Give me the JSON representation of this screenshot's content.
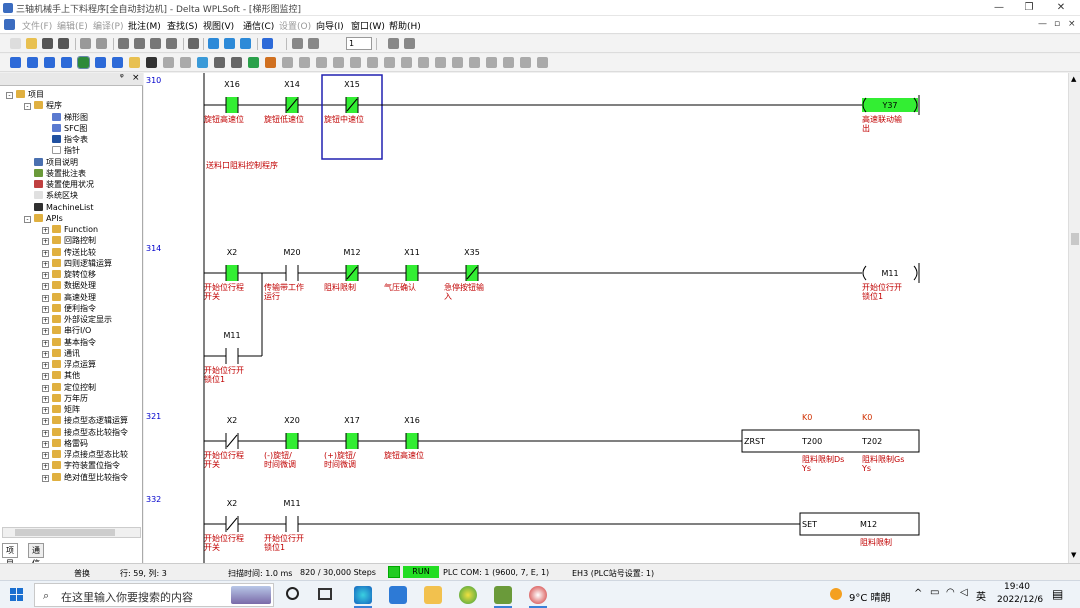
{
  "window": {
    "title": "三轴机械手上下料程序[全自动封边机] - Delta WPLSoft - [梯形图监控]",
    "controls": [
      "—",
      "❐",
      "✕"
    ]
  },
  "menu": {
    "items": [
      {
        "label": "文件(F)",
        "enabled": false
      },
      {
        "label": "编辑(E)",
        "enabled": false
      },
      {
        "label": "编译(P)",
        "enabled": false
      },
      {
        "label": "批注(M)",
        "enabled": true
      },
      {
        "label": "查找(S)",
        "enabled": true
      },
      {
        "label": "视图(V)",
        "enabled": true
      },
      {
        "label": "通信(C)",
        "enabled": true
      },
      {
        "label": "设置(O)",
        "enabled": false
      },
      {
        "label": "向导(I)",
        "enabled": true
      },
      {
        "label": "窗口(W)",
        "enabled": true
      },
      {
        "label": "帮助(H)",
        "enabled": true
      }
    ],
    "mdi_controls": [
      "—",
      "▫",
      "×"
    ]
  },
  "toolbar": {
    "step_value": "1"
  },
  "left_panel": {
    "pin_label": "ᵠ",
    "close_label": "×",
    "tree": [
      {
        "label": "项目",
        "level": 0,
        "pm": "-",
        "icon": "project-icon",
        "color": "#e0b040"
      },
      {
        "label": "程序",
        "level": 1,
        "pm": "-",
        "icon": "program-icon",
        "color": "#e0b040"
      },
      {
        "label": "梯形图",
        "level": 2,
        "pm": "",
        "icon": "ladder-icon",
        "color": "#5a7ad0"
      },
      {
        "label": "SFC图",
        "level": 2,
        "pm": "",
        "icon": "sfc-icon",
        "color": "#5a7ad0"
      },
      {
        "label": "指令表",
        "level": 2,
        "pm": "",
        "icon": "instruction-list-icon",
        "color": "#2050a0"
      },
      {
        "label": "指针",
        "level": 2,
        "pm": "",
        "icon": "pointer-icon",
        "color": "#ffffff"
      },
      {
        "label": "项目说明",
        "level": 1,
        "pm": "",
        "icon": "description-icon",
        "color": "#4a70b0"
      },
      {
        "label": "装置批注表",
        "level": 1,
        "pm": "",
        "icon": "device-comment-icon",
        "color": "#6a9a3a"
      },
      {
        "label": "装置使用状况",
        "level": 1,
        "pm": "",
        "icon": "device-usage-icon",
        "color": "#c04040"
      },
      {
        "label": "系统区块",
        "level": 1,
        "pm": "",
        "icon": "system-block-icon",
        "color": "#e0e0e0"
      },
      {
        "label": "MachineList",
        "level": 1,
        "pm": "",
        "icon": "machine-list-icon",
        "color": "#303030"
      },
      {
        "label": "APIs",
        "level": 1,
        "pm": "-",
        "icon": "apis-icon",
        "color": "#e0b040"
      },
      {
        "label": "Function",
        "level": 2,
        "pm": "+",
        "icon": "folder-icon",
        "color": "#e0b040"
      },
      {
        "label": "回路控制",
        "level": 2,
        "pm": "+",
        "icon": "folder-icon",
        "color": "#e0b040"
      },
      {
        "label": "传送比较",
        "level": 2,
        "pm": "+",
        "icon": "folder-icon",
        "color": "#e0b040"
      },
      {
        "label": "四则逻辑运算",
        "level": 2,
        "pm": "+",
        "icon": "folder-icon",
        "color": "#e0b040"
      },
      {
        "label": "旋转位移",
        "level": 2,
        "pm": "+",
        "icon": "folder-icon",
        "color": "#e0b040"
      },
      {
        "label": "数据处理",
        "level": 2,
        "pm": "+",
        "icon": "folder-icon",
        "color": "#e0b040"
      },
      {
        "label": "高速处理",
        "level": 2,
        "pm": "+",
        "icon": "folder-icon",
        "color": "#e0b040"
      },
      {
        "label": "便利指令",
        "level": 2,
        "pm": "+",
        "icon": "folder-icon",
        "color": "#e0b040"
      },
      {
        "label": "外部设定显示",
        "level": 2,
        "pm": "+",
        "icon": "folder-icon",
        "color": "#e0b040"
      },
      {
        "label": "串行I/O",
        "level": 2,
        "pm": "+",
        "icon": "folder-icon",
        "color": "#e0b040"
      },
      {
        "label": "基本指令",
        "level": 2,
        "pm": "+",
        "icon": "folder-icon",
        "color": "#e0b040"
      },
      {
        "label": "通讯",
        "level": 2,
        "pm": "+",
        "icon": "folder-icon",
        "color": "#e0b040"
      },
      {
        "label": "浮点运算",
        "level": 2,
        "pm": "+",
        "icon": "folder-icon",
        "color": "#e0b040"
      },
      {
        "label": "其他",
        "level": 2,
        "pm": "+",
        "icon": "folder-icon",
        "color": "#e0b040"
      },
      {
        "label": "定位控制",
        "level": 2,
        "pm": "+",
        "icon": "folder-icon",
        "color": "#e0b040"
      },
      {
        "label": "万年历",
        "level": 2,
        "pm": "+",
        "icon": "folder-icon",
        "color": "#e0b040"
      },
      {
        "label": "矩阵",
        "level": 2,
        "pm": "+",
        "icon": "folder-icon",
        "color": "#e0b040"
      },
      {
        "label": "接点型态逻辑运算",
        "level": 2,
        "pm": "+",
        "icon": "folder-icon",
        "color": "#e0b040"
      },
      {
        "label": "接点型态比较指令",
        "level": 2,
        "pm": "+",
        "icon": "folder-icon",
        "color": "#e0b040"
      },
      {
        "label": "格雷码",
        "level": 2,
        "pm": "+",
        "icon": "folder-icon",
        "color": "#e0b040"
      },
      {
        "label": "浮点接点型态比较",
        "level": 2,
        "pm": "+",
        "icon": "folder-icon",
        "color": "#e0b040"
      },
      {
        "label": "字符装置位指令",
        "level": 2,
        "pm": "+",
        "icon": "folder-icon",
        "color": "#e0b040"
      },
      {
        "label": "绝对值型比较指令",
        "level": 2,
        "pm": "+",
        "icon": "folder-icon",
        "color": "#e0b040"
      }
    ],
    "tabs": [
      "项目",
      "通信"
    ]
  },
  "ladder": {
    "rungs": [
      {
        "step": "310",
        "contacts": [
          {
            "device": "X16",
            "type": "NO",
            "on": true,
            "comment": [
              "旋钮高速位"
            ]
          },
          {
            "device": "X14",
            "type": "NC",
            "on": true,
            "comment": [
              "旋钮低速位"
            ]
          },
          {
            "device": "X15",
            "type": "NC",
            "on": true,
            "comment": [
              "旋钮中速位"
            ],
            "selected": true
          }
        ],
        "coil": {
          "device": "Y37",
          "on": true,
          "comment": [
            "高速联动输",
            "出"
          ]
        },
        "note": "送料口阻料控制程序"
      },
      {
        "step": "314",
        "contacts": [
          {
            "device": "X2",
            "type": "NO",
            "on": true,
            "comment": [
              "开始位行程",
              "开关"
            ]
          },
          {
            "device": "M20",
            "type": "NO",
            "on": false,
            "comment": [
              "传输带工作",
              "运行"
            ]
          },
          {
            "device": "M12",
            "type": "NC",
            "on": true,
            "comment": [
              "阻料限制"
            ]
          },
          {
            "device": "X11",
            "type": "NO",
            "on": true,
            "comment": [
              "气压确认"
            ]
          },
          {
            "device": "X35",
            "type": "NC",
            "on": true,
            "comment": [
              "急停按钮输",
              "入"
            ]
          }
        ],
        "branch": {
          "device": "M11",
          "type": "NO",
          "on": false,
          "comment": [
            "开始位行开",
            "锁位1"
          ]
        },
        "coil": {
          "device": "M11",
          "on": false,
          "comment": [
            "开始位行开",
            "锁位1"
          ]
        }
      },
      {
        "step": "321",
        "contacts": [
          {
            "device": "X2",
            "type": "NC",
            "on": false,
            "comment": [
              "开始位行程",
              "开关"
            ]
          },
          {
            "device": "X20",
            "type": "NO",
            "on": true,
            "comment": [
              "(-)旋钮/",
              "时间微调"
            ]
          },
          {
            "device": "X17",
            "type": "NO",
            "on": true,
            "comment": [
              "(+)旋钮/",
              "时间微调"
            ]
          },
          {
            "device": "X16",
            "type": "NO",
            "on": true,
            "comment": [
              "旋钮高速位"
            ]
          }
        ],
        "instruction": {
          "op": "ZRST",
          "args": [
            "T200",
            "T202"
          ],
          "values": [
            "K0",
            "K0"
          ],
          "comments": [
            [
              "阻料限制Ds",
              "Ys"
            ],
            [
              "阻料限制Gs",
              "Ys"
            ]
          ]
        }
      },
      {
        "step": "332",
        "contacts": [
          {
            "device": "X2",
            "type": "NC",
            "on": false,
            "comment": [
              "开始位行程",
              "开关"
            ]
          },
          {
            "device": "M11",
            "type": "NO",
            "on": false,
            "comment": [
              "开始位行开",
              "锁位1"
            ]
          }
        ],
        "instruction": {
          "op": "SET",
          "args": [
            "M12"
          ],
          "values": [],
          "comments": [
            [
              "阻料限制"
            ]
          ]
        }
      }
    ],
    "colors": {
      "on": "#33ee33",
      "comment": "#c00000",
      "step": "#0000cc",
      "kvalue": "#d03000",
      "selection": "#2020b0"
    }
  },
  "status": {
    "mode": "普换",
    "cursor": "行: 59, 列: 3",
    "scan_time": "扫描时间: 1.0 ms",
    "steps": "820 / 30,000 Steps",
    "run": "RUN",
    "plc_com": "PLC COM: 1 (9600, 7, E, 1)",
    "plc_model": "EH3 (PLC站号设置: 1)"
  },
  "taskbar": {
    "search_placeholder": "在这里输入你要搜索的内容",
    "weather": "9°C 晴朗",
    "ime": "英",
    "time": "19:40",
    "date": "2022/12/6"
  }
}
